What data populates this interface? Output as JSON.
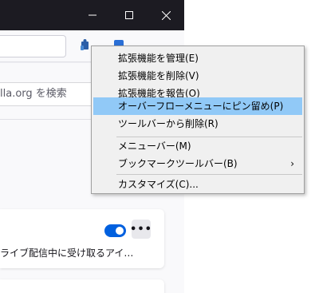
{
  "window": {
    "controls": {
      "minimize_icon": "minimize-icon",
      "maximize_icon": "maximize-icon",
      "close_icon": "close-icon"
    }
  },
  "page": {
    "search_placeholder": "lla.org を検索",
    "extension_card": {
      "description": "ライブ配信中に受け取るアイ…",
      "more_label": "•••",
      "enabled": true
    }
  },
  "context_menu": {
    "items": [
      {
        "label": "拡張機能を管理(E)"
      },
      {
        "label": "拡張機能を削除(V)"
      },
      {
        "label": "拡張機能を報告(O)"
      },
      {
        "label": "オーバーフローメニューにピン留め(P)",
        "highlighted": true
      },
      {
        "label": "ツールバーから削除(R)"
      },
      {
        "label": "メニューバー(M)"
      },
      {
        "label": "ブックマークツールバー(B)",
        "submenu": true
      },
      {
        "label": "カスタマイズ(C)..."
      }
    ],
    "submenu_arrow": "›"
  },
  "colors": {
    "titlebar": "#1c1b22",
    "menu_highlight": "#91c9f7",
    "toggle_on": "#0060df"
  }
}
